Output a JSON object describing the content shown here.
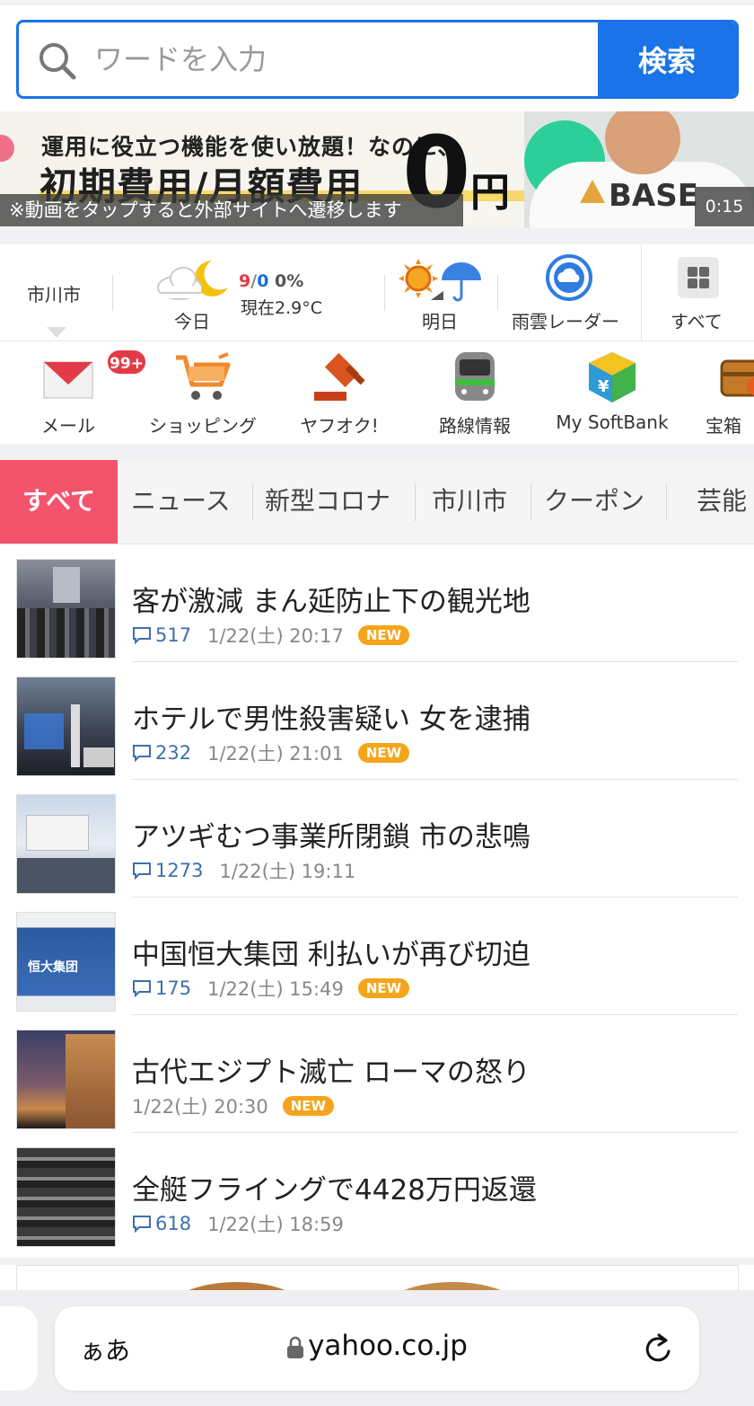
{
  "search": {
    "placeholder": "ワードを入力",
    "button_label": "検索"
  },
  "ad": {
    "line1": "運用に役立つ機能を使い放題！なのに、",
    "line2": "初期費用/月額費用",
    "zero": "0",
    "yen": "円",
    "brand": "BASE",
    "caption": "※動画をタップすると外部サイトへ遷移します",
    "time": "0:15"
  },
  "weather": {
    "city": "市川市",
    "today_label": "今日",
    "high": "9",
    "slash": "/",
    "low": "0",
    "rain": "0%",
    "current": "現在2.9°C",
    "tomorrow_label": "明日",
    "radar_label": "雨雲レーダー",
    "all_label": "すべて"
  },
  "services": [
    {
      "label": "メール",
      "badge": "99+"
    },
    {
      "label": "ショッピング"
    },
    {
      "label": "ヤフオク!"
    },
    {
      "label": "路線情報"
    },
    {
      "label": "My SoftBank"
    },
    {
      "label": "宝箱"
    }
  ],
  "tabs": [
    "すべて",
    "ニュース",
    "新型コロナ",
    "市川市",
    "クーポン",
    "芸能"
  ],
  "news": [
    {
      "title": "客が激減 まん延防止下の観光地",
      "comments": "517",
      "time": "1/22(土) 20:17",
      "new": "NEW"
    },
    {
      "title": "ホテルで男性殺害疑い 女を逮捕",
      "comments": "232",
      "time": "1/22(土) 21:01",
      "new": "NEW"
    },
    {
      "title": "アツギむつ事業所閉鎖 市の悲鳴",
      "comments": "1273",
      "time": "1/22(土) 19:11"
    },
    {
      "title": "中国恒大集団 利払いが再び切迫",
      "comments": "175",
      "time": "1/22(土) 15:49",
      "new": "NEW"
    },
    {
      "title": "古代エジプト滅亡 ローマの怒り",
      "time": "1/22(土) 20:30",
      "new": "NEW"
    },
    {
      "title": "全艇フライングで4428万円返還",
      "comments": "618",
      "time": "1/22(土) 18:59"
    }
  ],
  "thumb_captions": {
    "evergrande_logo": "恒大集团"
  },
  "browser": {
    "aa": "ぁあ",
    "url": "yahoo.co.jp"
  },
  "colors": {
    "accent": "#1a73e8",
    "tab_active": "#f3536b",
    "badge_red": "#e23b47",
    "new_badge": "#f4a51c",
    "comment_blue": "#3d6fb0"
  },
  "icons": {
    "search": "search-icon",
    "weather_today": "cloud-moon-icon",
    "weather_tomorrow": "sun-umbrella-icon",
    "radar": "radar-icon",
    "all": "grid-icon",
    "mail": "mail-icon",
    "shopping": "cart-icon",
    "auction": "gavel-icon",
    "train": "train-icon",
    "softbank": "softbank-cube-icon",
    "treasure": "treasure-chest-icon",
    "comment": "comment-icon",
    "lock": "lock-icon",
    "reload": "reload-icon"
  }
}
